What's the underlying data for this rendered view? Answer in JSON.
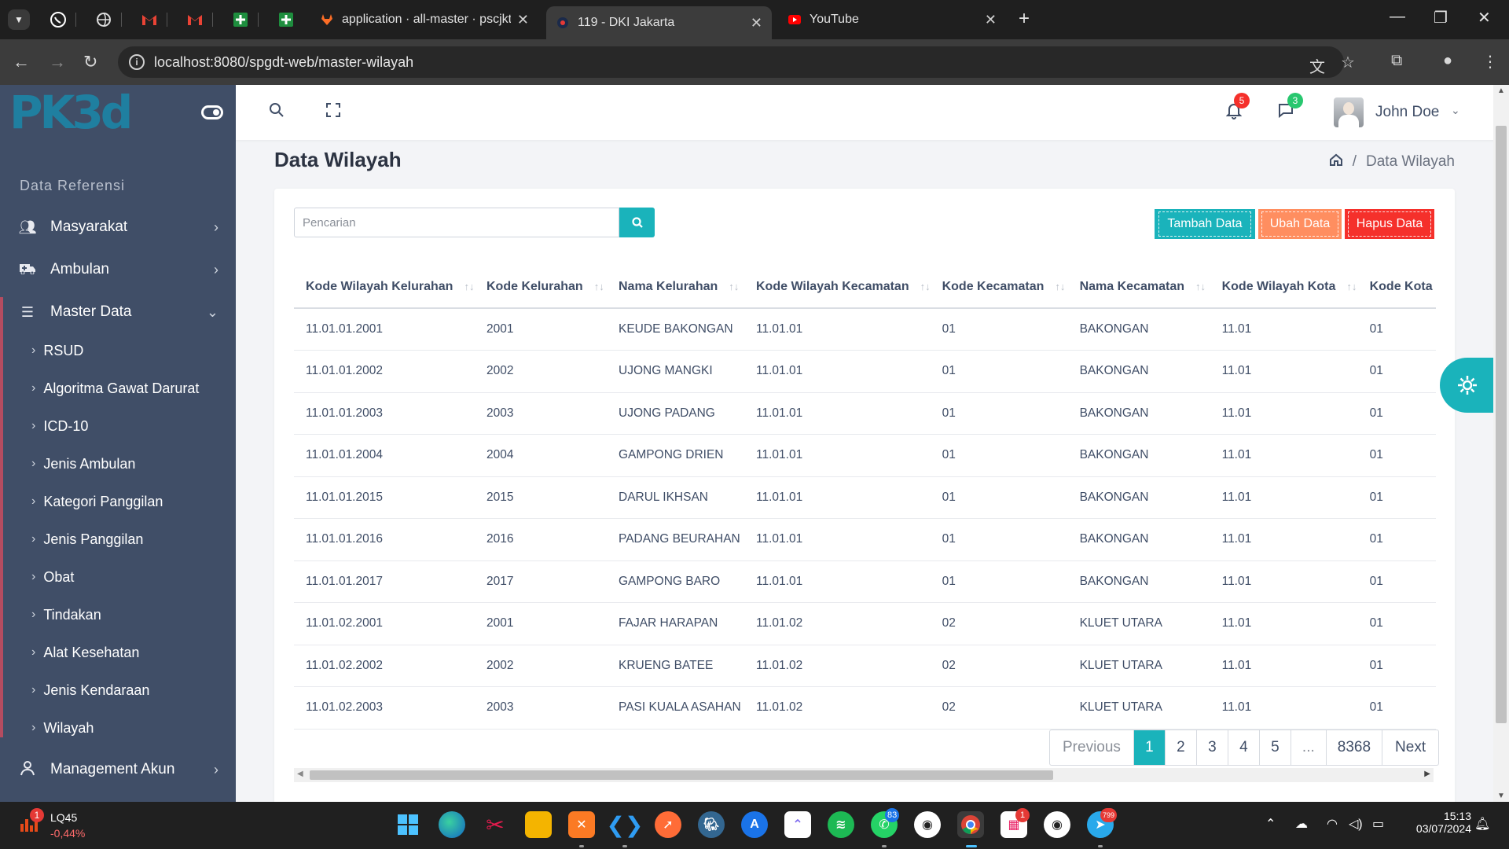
{
  "browser": {
    "tabs": [
      {
        "title": "application · all-master · pscjkt /",
        "active": false
      },
      {
        "title": "119 - DKI Jakarta",
        "active": true
      },
      {
        "title": "YouTube",
        "active": false
      }
    ],
    "url": "localhost:8080/spgdt-web/master-wilayah",
    "pinned_icons": [
      "whatsapp-icon",
      "globe-icon",
      "gmail-icon",
      "gmail-icon",
      "sheets-icon",
      "sheets-icon"
    ]
  },
  "sidebar": {
    "logo": "PK3d",
    "section": "Data Referensi",
    "menu": [
      {
        "label": "Masyarakat",
        "icon": "users-icon"
      },
      {
        "label": "Ambulan",
        "icon": "ambulance-icon"
      },
      {
        "label": "Master Data",
        "icon": "list-icon"
      }
    ],
    "submenu": [
      "RSUD",
      "Algoritma Gawat Darurat",
      "ICD-10",
      "Jenis Ambulan",
      "Kategori Panggilan",
      "Jenis Panggilan",
      "Obat",
      "Tindakan",
      "Alat Kesehatan",
      "Jenis Kendaraan",
      "Wilayah"
    ],
    "bottom_menu": {
      "label": "Management Akun",
      "icon": "user-icon"
    }
  },
  "header": {
    "notif_count": "5",
    "chat_count": "3",
    "user_name": "John Doe"
  },
  "page": {
    "title": "Data Wilayah",
    "breadcrumb": "Data Wilayah"
  },
  "toolbar": {
    "search_placeholder": "Pencarian",
    "add_label": "Tambah Data",
    "edit_label": "Ubah Data",
    "delete_label": "Hapus Data"
  },
  "table": {
    "columns": [
      "Kode Wilayah Kelurahan",
      "Kode Kelurahan",
      "Nama Kelurahan",
      "Kode Wilayah Kecamatan",
      "Kode Kecamatan",
      "Nama Kecamatan",
      "Kode Wilayah Kota",
      "Kode Kota"
    ],
    "rows": [
      [
        "11.01.01.2001",
        "2001",
        "KEUDE BAKONGAN",
        "11.01.01",
        "01",
        "BAKONGAN",
        "11.01",
        "01"
      ],
      [
        "11.01.01.2002",
        "2002",
        "UJONG MANGKI",
        "11.01.01",
        "01",
        "BAKONGAN",
        "11.01",
        "01"
      ],
      [
        "11.01.01.2003",
        "2003",
        "UJONG PADANG",
        "11.01.01",
        "01",
        "BAKONGAN",
        "11.01",
        "01"
      ],
      [
        "11.01.01.2004",
        "2004",
        "GAMPONG DRIEN",
        "11.01.01",
        "01",
        "BAKONGAN",
        "11.01",
        "01"
      ],
      [
        "11.01.01.2015",
        "2015",
        "DARUL IKHSAN",
        "11.01.01",
        "01",
        "BAKONGAN",
        "11.01",
        "01"
      ],
      [
        "11.01.01.2016",
        "2016",
        "PADANG BEURAHAN",
        "11.01.01",
        "01",
        "BAKONGAN",
        "11.01",
        "01"
      ],
      [
        "11.01.01.2017",
        "2017",
        "GAMPONG BARO",
        "11.01.01",
        "01",
        "BAKONGAN",
        "11.01",
        "01"
      ],
      [
        "11.01.02.2001",
        "2001",
        "FAJAR HARAPAN",
        "11.01.02",
        "02",
        "KLUET UTARA",
        "11.01",
        "01"
      ],
      [
        "11.01.02.2002",
        "2002",
        "KRUENG BATEE",
        "11.01.02",
        "02",
        "KLUET UTARA",
        "11.01",
        "01"
      ],
      [
        "11.01.02.2003",
        "2003",
        "PASI KUALA ASAHAN",
        "11.01.02",
        "02",
        "KLUET UTARA",
        "11.01",
        "01"
      ]
    ]
  },
  "pagination": {
    "previous": "Previous",
    "pages": [
      "1",
      "2",
      "3",
      "4",
      "5",
      "...",
      "8368"
    ],
    "active_page": "1",
    "next": "Next"
  },
  "taskbar": {
    "stock_name": "LQ45",
    "stock_change": "-0,44%",
    "stock_badge": "1",
    "whatsapp_badge": "83",
    "app_badge": "1",
    "telegram_badge": "799",
    "time": "15:13",
    "date": "03/07/2024"
  },
  "colors": {
    "sidebar_bg": "#404e67",
    "accent_teal": "#1ab3bb",
    "edit_orange": "#ff8e60",
    "delete_red": "#f5302b"
  }
}
